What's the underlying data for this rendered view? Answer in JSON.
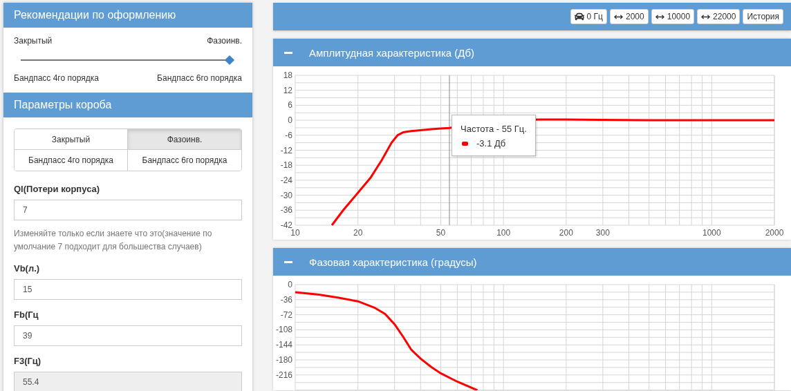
{
  "recommendations": {
    "title": "Рекомендации по оформлению",
    "slider": {
      "top_left": "Закрытый",
      "top_right": "Фазоинв.",
      "bottom_left": "Бандпасс 4го порядка",
      "bottom_right": "Бандпасс 6го порядка",
      "level": 1
    }
  },
  "box_params": {
    "title": "Параметры короба",
    "box_types": [
      {
        "label": "Закрытый",
        "selected": false
      },
      {
        "label": "Фазоинв.",
        "selected": true
      },
      {
        "label": "Бандпасс 4го порядка",
        "selected": false
      },
      {
        "label": "Бандпасс 6го порядка",
        "selected": false
      }
    ],
    "fields": [
      {
        "label": "Ql(Потери корпуса)",
        "value": "7",
        "disabled": false,
        "help": "Изменяйте только если знаете что это(значение по умолчание 7 подходит для большества случаев)"
      },
      {
        "label": "Vb(л.)",
        "value": "15",
        "disabled": false
      },
      {
        "label": "Fb(Гц",
        "value": "39",
        "disabled": false
      },
      {
        "label": "F3(Гц)",
        "value": "55.4",
        "disabled": true
      }
    ]
  },
  "toolbar": {
    "buttons": [
      {
        "kind": "car",
        "label": "0 Гц"
      },
      {
        "kind": "range",
        "label": "2000"
      },
      {
        "kind": "range",
        "label": "10000"
      },
      {
        "kind": "range",
        "label": "22000"
      },
      {
        "kind": "plain",
        "label": "История"
      }
    ]
  },
  "amplitude_panel": {
    "title": "Амплитудная характеристика (Дб)",
    "expanded": true,
    "tooltip": {
      "title": "Частота - 55 Гц.",
      "value": "-3.1 Дб",
      "color": "#ff0000"
    },
    "y_axis_labels": [
      "18",
      "12",
      "6",
      "0",
      "-6",
      "-12",
      "-18",
      "-24",
      "-30",
      "-36",
      "-42"
    ],
    "x_axis_labels": [
      "10",
      "20",
      "50",
      "100",
      "200",
      "300",
      "1000",
      "2000"
    ]
  },
  "phase_panel": {
    "title": "Фазовая характеристика (градусы)",
    "expanded": true,
    "y_axis_labels": [
      "0",
      "-36",
      "-72",
      "-108",
      "-144",
      "-180",
      "-216"
    ]
  }
}
